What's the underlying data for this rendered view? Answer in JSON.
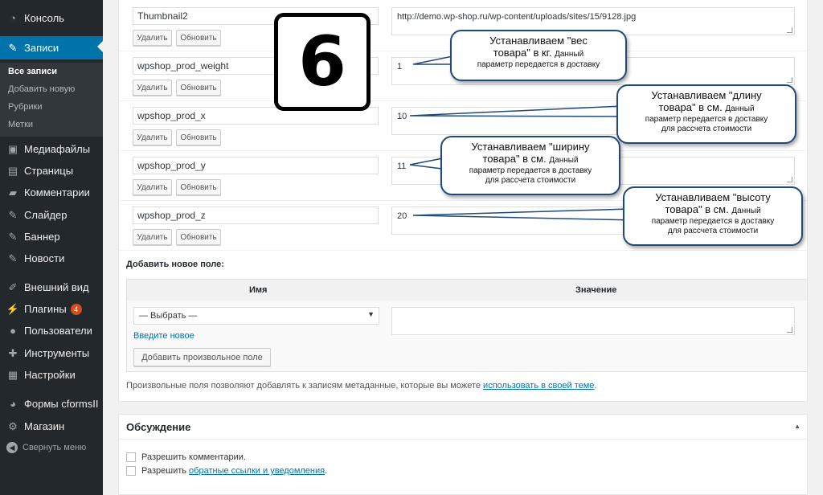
{
  "sidebar": {
    "items": [
      {
        "label": "Консоль",
        "icon": "dashboard-icon"
      },
      {
        "label": "Записи",
        "icon": "pin-icon",
        "active": true
      },
      {
        "label": "Медиафайлы",
        "icon": "media-icon"
      },
      {
        "label": "Страницы",
        "icon": "pages-icon"
      },
      {
        "label": "Комментарии",
        "icon": "comments-icon"
      },
      {
        "label": "Слайдер",
        "icon": "pin-icon"
      },
      {
        "label": "Баннер",
        "icon": "pin-icon"
      },
      {
        "label": "Новости",
        "icon": "pin-icon"
      },
      {
        "label": "Внешний вид",
        "icon": "brush-icon"
      },
      {
        "label": "Плагины",
        "icon": "plugin-icon",
        "badge": "4"
      },
      {
        "label": "Пользователи",
        "icon": "users-icon"
      },
      {
        "label": "Инструменты",
        "icon": "wrench-icon"
      },
      {
        "label": "Настройки",
        "icon": "settings-icon"
      },
      {
        "label": "Формы cformsII",
        "icon": "forms-icon"
      },
      {
        "label": "Магазин",
        "icon": "gear-icon"
      }
    ],
    "submenu": [
      "Все записи",
      "Добавить новую",
      "Рубрики",
      "Метки"
    ],
    "collapse_label": "Свернуть меню"
  },
  "custom_fields": {
    "delete_label": "Удалить",
    "update_label": "Обновить",
    "rows": [
      {
        "key": "Thumbnail2",
        "value": "http://demo.wp-shop.ru/wp-content/uploads/sites/15/9128.jpg"
      },
      {
        "key": "wpshop_prod_weight",
        "value": "1"
      },
      {
        "key": "wpshop_prod_x",
        "value": "10"
      },
      {
        "key": "wpshop_prod_y",
        "value": "11"
      },
      {
        "key": "wpshop_prod_z",
        "value": "20"
      }
    ]
  },
  "add_field": {
    "title": "Добавить новое поле:",
    "col_name": "Имя",
    "col_value": "Значение",
    "select_value": "— Выбрать —",
    "enter_new_link": "Введите новое",
    "add_button": "Добавить произвольное поле"
  },
  "help": {
    "text_before": "Произвольные поля позволяют добавлять к записям метаданные, которые вы можете ",
    "link": "использовать в своей теме",
    "text_after": "."
  },
  "discussion": {
    "title": "Обсуждение",
    "allow_comments": "Разрешить комментарии.",
    "allow_trackbacks_prefix": "Разрешить ",
    "allow_trackbacks_link": "обратные ссылки и уведомления",
    "allow_trackbacks_suffix": "."
  },
  "step_number": "6",
  "callouts": {
    "weight": {
      "main1": "Устанавливаем \"вес",
      "main2": "товара\" в кг.",
      "sub1": "Данный",
      "sub2": "параметр передается в доставку"
    },
    "length": {
      "main1": "Устанавливаем \"длину",
      "main2": "товара\" в см.",
      "sub1": "Данный",
      "sub2": "параметр передается в доставку",
      "sub3": "для рассчета стоимости"
    },
    "width": {
      "main1": "Устанавливаем \"ширину",
      "main2": "товара\" в см.",
      "sub1": "Данный",
      "sub2": "параметр передается в доставку",
      "sub3": "для рассчета стоимости"
    },
    "height": {
      "main1": "Устанавливаем \"высоту",
      "main2": "товара\" в см.",
      "sub1": "Данный",
      "sub2": "параметр передается в доставку",
      "sub3": "для рассчета стоимости"
    }
  },
  "colors": {
    "sidebar_bg": "#23282d",
    "active_menu": "#0073aa",
    "callout_border": "#1f4a7a",
    "link": "#0073aa",
    "badge": "#d54e21"
  }
}
